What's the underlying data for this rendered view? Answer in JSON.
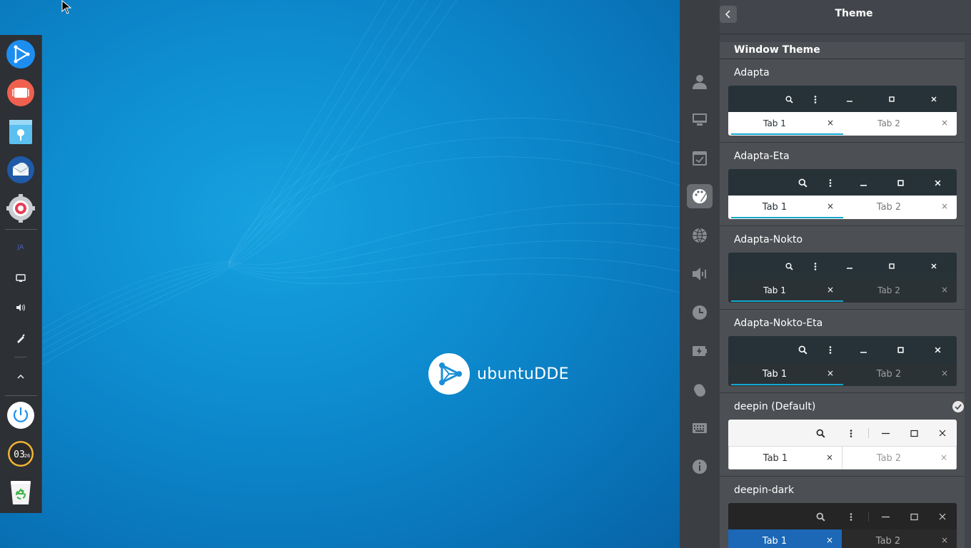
{
  "desktop": {
    "logo_text": "ubuntuDDE"
  },
  "dock": {
    "apps": [
      "launcher-icon",
      "multitasking-view-icon",
      "file-manager-icon",
      "mail-client-icon",
      "control-center-icon"
    ],
    "tray": {
      "input_method": "JA",
      "items": [
        "display-icon",
        "volume-icon",
        "pen-icon",
        "chevron-up-icon"
      ]
    },
    "clock_text": "03 26",
    "system": [
      "power-icon",
      "clock-icon",
      "trash-icon"
    ]
  },
  "control_center": {
    "title": "Theme",
    "nav": [
      "account-icon",
      "display-icon",
      "default-apps-icon",
      "personalization-icon",
      "network-icon",
      "sound-icon",
      "datetime-icon",
      "power-icon",
      "mouse-icon",
      "keyboard-icon",
      "info-icon"
    ],
    "active_nav": "personalization-icon",
    "section_title": "Window Theme",
    "themes": [
      {
        "name": "Adapta",
        "tab1": "Tab 1",
        "tab2": "Tab 2",
        "close": "×"
      },
      {
        "name": "Adapta-Eta",
        "tab1": "Tab 1",
        "tab2": "Tab 2",
        "close": "×"
      },
      {
        "name": "Adapta-Nokto",
        "tab1": "Tab 1",
        "tab2": "Tab 2",
        "close": "×"
      },
      {
        "name": "Adapta-Nokto-Eta",
        "tab1": "Tab 1",
        "tab2": "Tab 2",
        "close": "×"
      },
      {
        "name": "deepin (Default)",
        "tab1": "Tab 1",
        "tab2": "Tab 2",
        "close": "×",
        "selected": true
      },
      {
        "name": "deepin-dark",
        "tab1": "Tab 1",
        "tab2": "Tab 2",
        "close": "×"
      }
    ]
  },
  "colors": {
    "accent": "#13a8d0",
    "deepin_dark_tab": "#1c68b6",
    "panel_bg": "#42454b"
  }
}
